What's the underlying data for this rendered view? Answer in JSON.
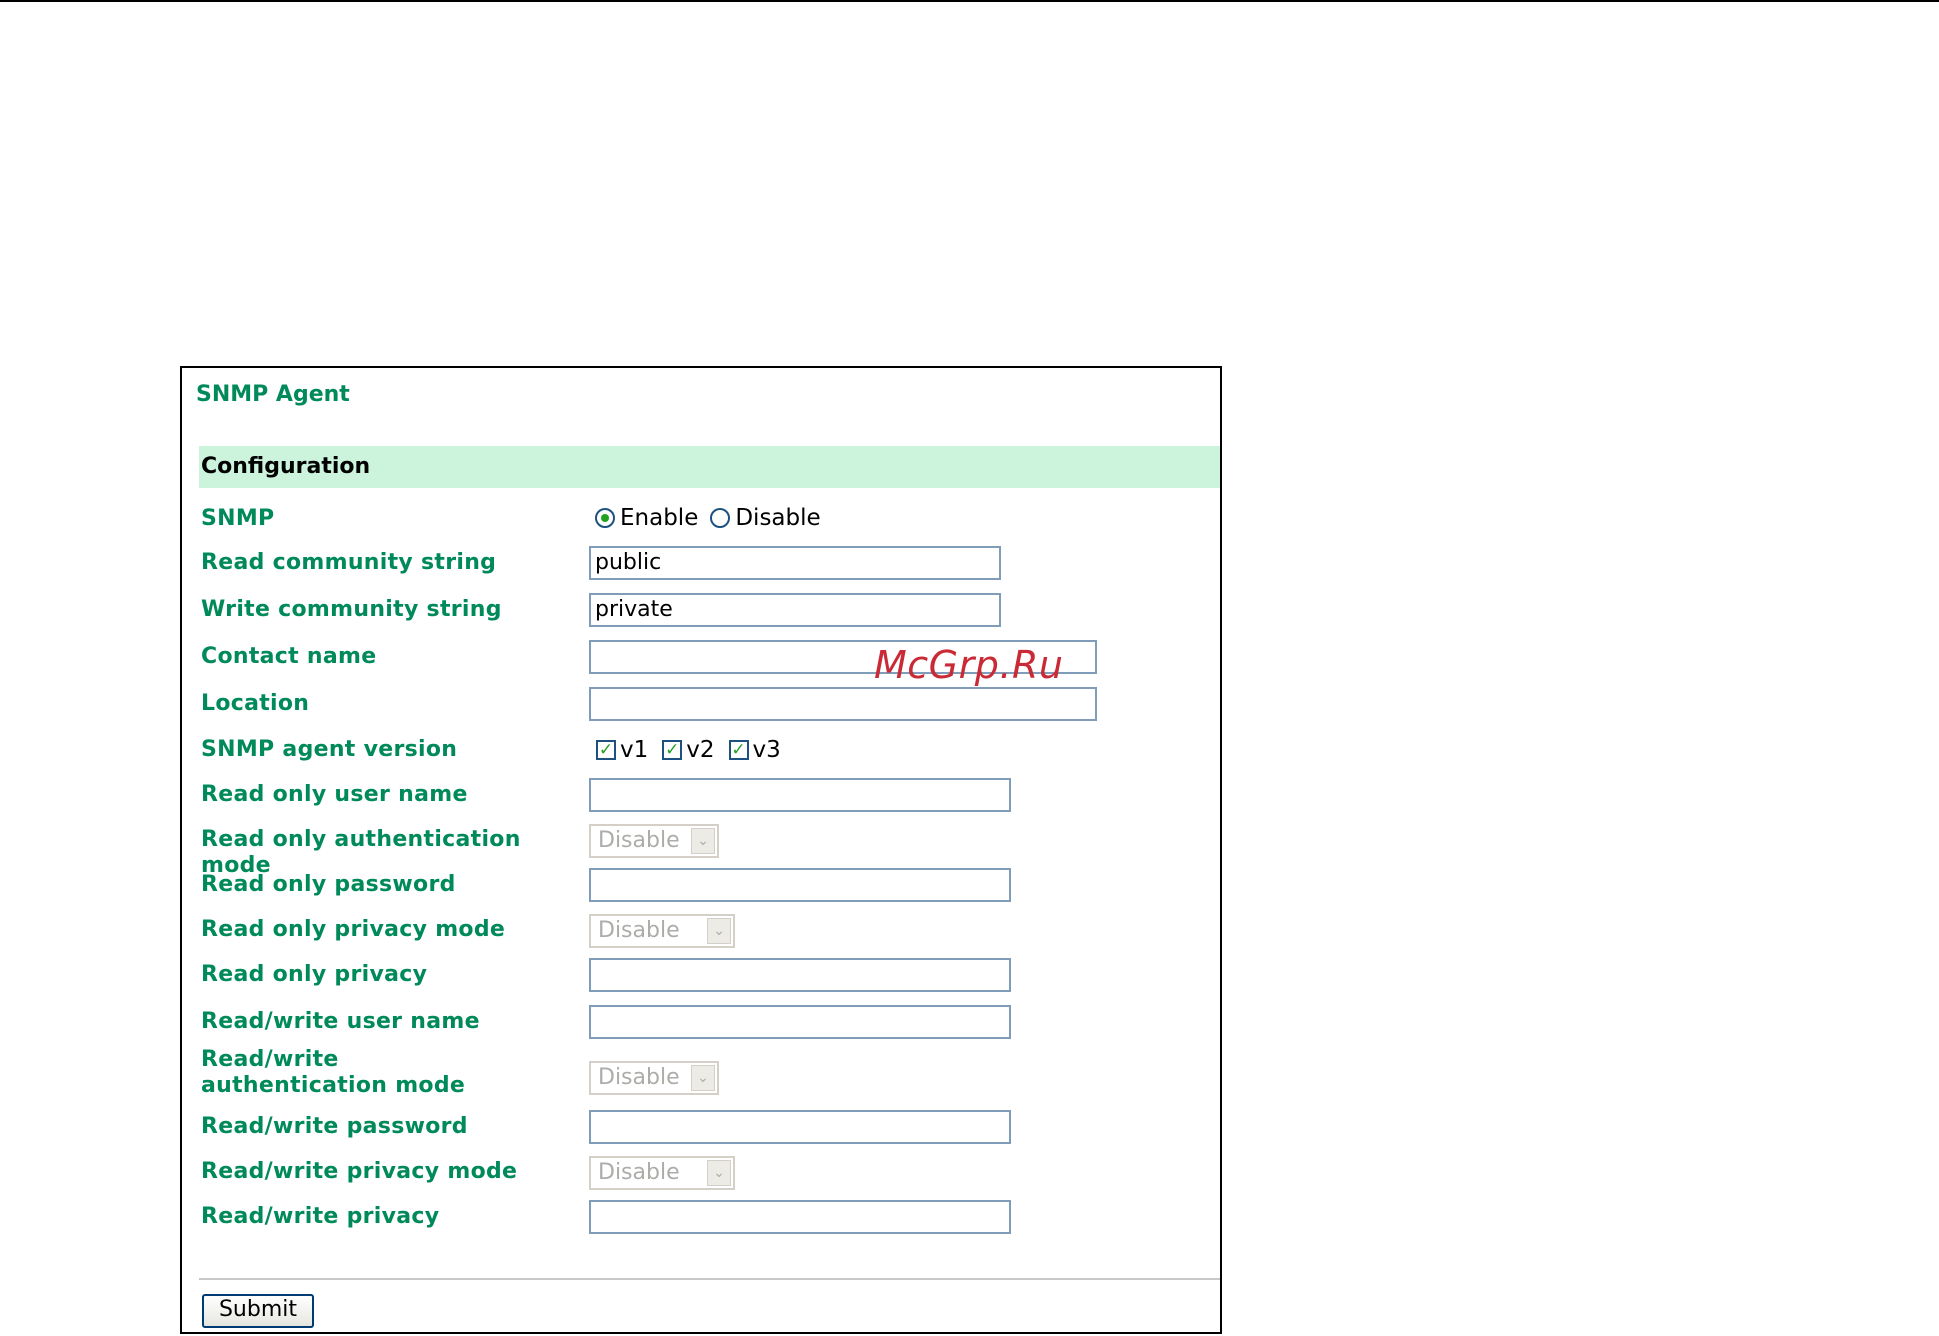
{
  "panel": {
    "title": "SNMP Agent",
    "section": "Configuration"
  },
  "fields": {
    "snmp": {
      "label": "SNMP",
      "options": [
        "Enable",
        "Disable"
      ],
      "selected": "Enable"
    },
    "read_community": {
      "label": "Read community string",
      "value": "public"
    },
    "write_community": {
      "label": "Write community string",
      "value": "private"
    },
    "contact_name": {
      "label": "Contact name",
      "value": ""
    },
    "location": {
      "label": "Location",
      "value": ""
    },
    "agent_version": {
      "label": "SNMP agent version",
      "options": [
        {
          "label": "v1",
          "checked": true
        },
        {
          "label": "v2",
          "checked": true
        },
        {
          "label": "v3",
          "checked": true
        }
      ]
    },
    "ro_user": {
      "label": "Read only user name",
      "value": ""
    },
    "ro_auth_mode": {
      "label": "Read only authentication mode",
      "value": "Disable"
    },
    "ro_password": {
      "label": "Read only password",
      "value": ""
    },
    "ro_privacy_mode": {
      "label": "Read only privacy mode",
      "value": "Disable"
    },
    "ro_privacy": {
      "label": "Read only privacy",
      "value": ""
    },
    "rw_user": {
      "label": "Read/write user name",
      "value": ""
    },
    "rw_auth_mode": {
      "label": "Read/write authentication mode",
      "value": "Disable"
    },
    "rw_password": {
      "label": "Read/write password",
      "value": ""
    },
    "rw_privacy_mode": {
      "label": "Read/write privacy mode",
      "value": "Disable"
    },
    "rw_privacy": {
      "label": "Read/write privacy",
      "value": ""
    }
  },
  "actions": {
    "submit_label": "Submit"
  },
  "watermark": "McGrp.Ru",
  "colors": {
    "label_green": "#008a5a",
    "header_bg": "#ccf3dc",
    "check_green": "#21a121",
    "watermark_red": "#c92a36"
  }
}
